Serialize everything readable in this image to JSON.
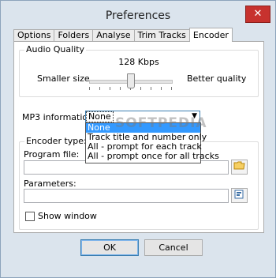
{
  "window": {
    "title": "Preferences",
    "close_glyph": "✕"
  },
  "tabs": [
    {
      "label": "Options",
      "active": false
    },
    {
      "label": "Folders",
      "active": false
    },
    {
      "label": "Analyse",
      "active": false
    },
    {
      "label": "Trim Tracks",
      "active": false
    },
    {
      "label": "Encoder",
      "active": true
    }
  ],
  "audio_quality": {
    "title": "Audio Quality",
    "bitrate": "128 Kbps",
    "smaller_label": "Smaller size",
    "better_label": "Better quality",
    "slider_fraction": 0.5
  },
  "mp3_info": {
    "label": "MP3 information:",
    "selected": "None",
    "options": [
      "None",
      "Track title and number only",
      "All - prompt for each track",
      "All - prompt once for all tracks"
    ]
  },
  "encoder": {
    "title": "Encoder type:",
    "program_label": "Program file:",
    "program_value": "",
    "parameters_label": "Parameters:",
    "parameters_value": "",
    "show_window_label": "Show window",
    "show_window_checked": false
  },
  "buttons": {
    "ok": "OK",
    "cancel": "Cancel",
    "encoder": "Encoder"
  },
  "watermark": "SOFTPEDIA",
  "colors": {
    "close": "#c7322e",
    "selection": "#3399ff",
    "window_bg": "#dbe4ed"
  }
}
